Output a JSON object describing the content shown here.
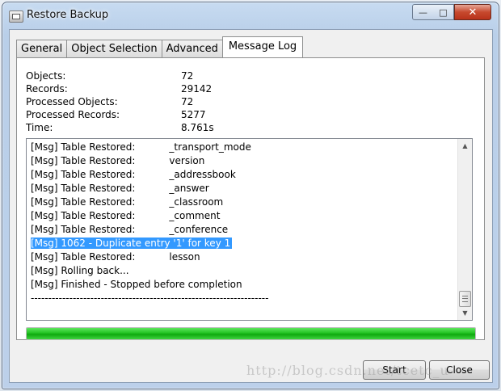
{
  "window": {
    "title": "Restore Backup",
    "controls": {
      "minimize": "—",
      "maximize": "□",
      "close": "✕"
    }
  },
  "tabs": [
    {
      "label": "General"
    },
    {
      "label": "Object Selection"
    },
    {
      "label": "Advanced"
    },
    {
      "label": "Message Log",
      "active": true
    }
  ],
  "stats": [
    {
      "label": "Objects:",
      "value": "72"
    },
    {
      "label": "Records:",
      "value": "29142"
    },
    {
      "label": "Processed Objects:",
      "value": "72"
    },
    {
      "label": "Processed Records:",
      "value": "5277"
    },
    {
      "label": "Time:",
      "value": "8.761s"
    }
  ],
  "log": [
    {
      "text": "[Msg] Table Restored:           _transport_mode"
    },
    {
      "text": "[Msg] Table Restored:           version"
    },
    {
      "text": "[Msg] Table Restored:           _addressbook"
    },
    {
      "text": "[Msg] Table Restored:           _answer"
    },
    {
      "text": "[Msg] Table Restored:           _classroom"
    },
    {
      "text": "[Msg] Table Restored:           _comment"
    },
    {
      "text": "[Msg] Table Restored:           _conference"
    },
    {
      "text": "[Msg] 1062 - Duplicate entry '1' for key 1",
      "selected": true
    },
    {
      "text": "[Msg] Table Restored:           lesson"
    },
    {
      "text": "[Msg] Rolling back..."
    },
    {
      "text": "[Msg] Finished - Stopped before completion"
    },
    {
      "text": "--------------------------------------------------------------------"
    }
  ],
  "progress": {
    "percent": 100,
    "color": "#22c322"
  },
  "buttons": {
    "start": "Start",
    "close": "Close"
  },
  "watermark": "http://blog.csdn.net/tcetc_u"
}
